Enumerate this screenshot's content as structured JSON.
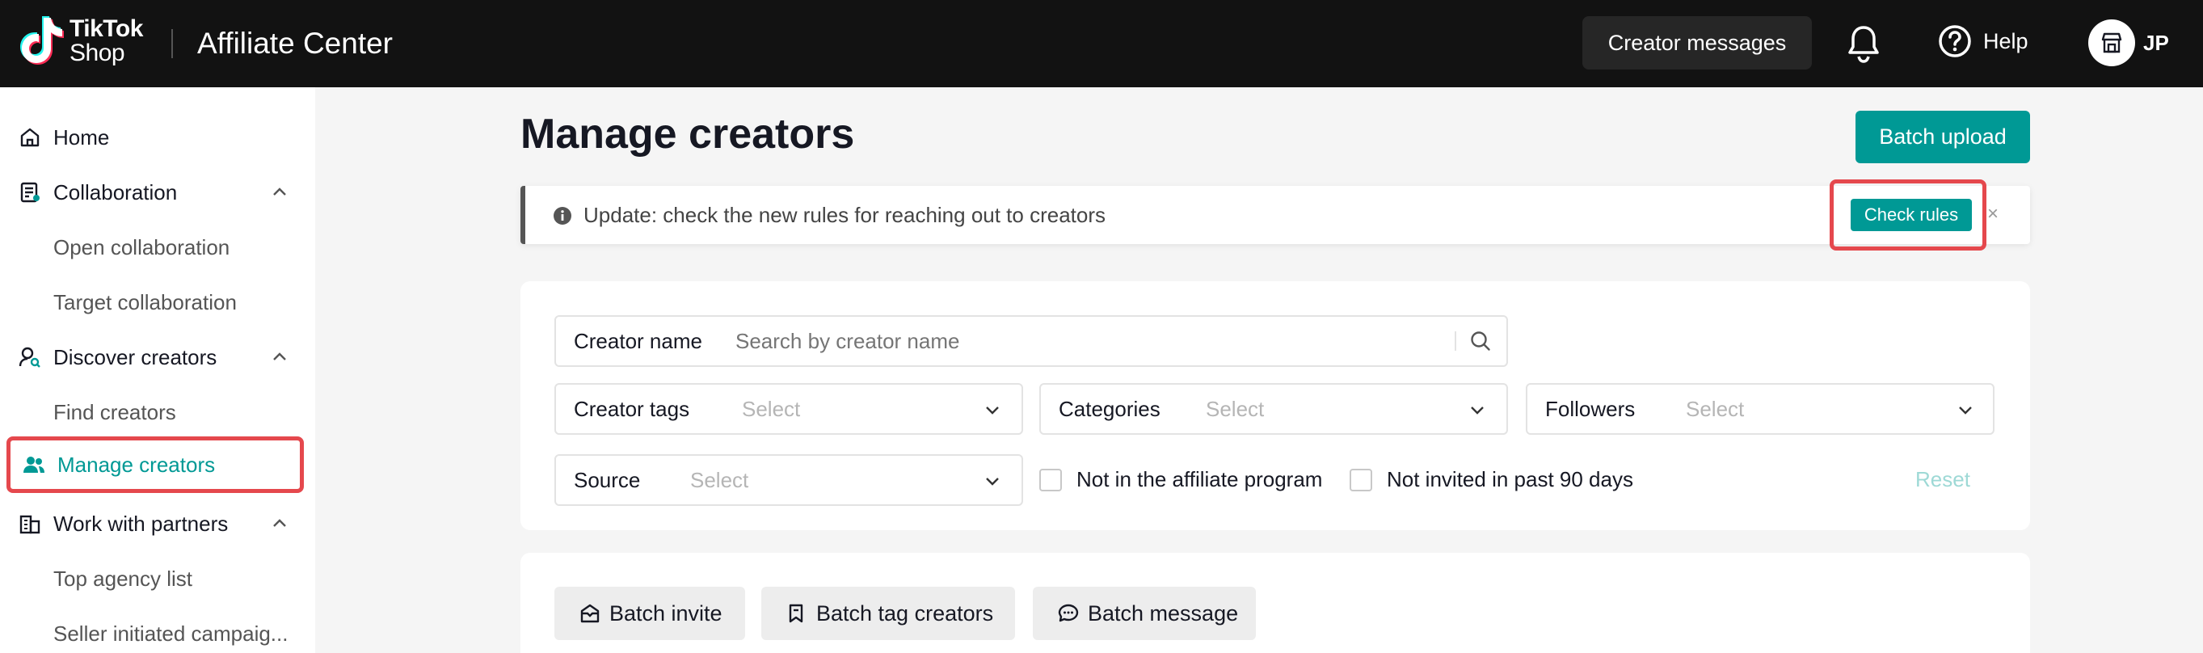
{
  "header": {
    "logo_line1": "TikTok",
    "logo_line2": "Shop",
    "app_title": "Affiliate Center",
    "creator_messages_label": "Creator messages",
    "help_label": "Help",
    "user_initials": "JP"
  },
  "sidebar": {
    "items": [
      {
        "label": "Home",
        "icon": "home-icon"
      },
      {
        "label": "Collaboration",
        "icon": "collaboration-icon",
        "expanded": true
      },
      {
        "label": "Open collaboration"
      },
      {
        "label": "Target collaboration"
      },
      {
        "label": "Discover creators",
        "icon": "discover-icon",
        "expanded": true
      },
      {
        "label": "Find creators"
      },
      {
        "label": "Manage creators",
        "icon": "users-icon",
        "active": true
      },
      {
        "label": "Work with partners",
        "icon": "partners-icon",
        "expanded": true
      },
      {
        "label": "Top agency list"
      },
      {
        "label": "Seller initiated campaig..."
      }
    ]
  },
  "main": {
    "page_title": "Manage creators",
    "batch_upload_label": "Batch upload",
    "notice": {
      "message": "Update: check the new rules for reaching out to creators",
      "action_label": "Check rules",
      "close_glyph": "×"
    },
    "filters": {
      "creator_name": {
        "label": "Creator name",
        "placeholder": "Search by creator name"
      },
      "creator_tags": {
        "label": "Creator tags",
        "value": "Select"
      },
      "categories": {
        "label": "Categories",
        "value": "Select"
      },
      "followers": {
        "label": "Followers",
        "value": "Select"
      },
      "source": {
        "label": "Source",
        "value": "Select"
      },
      "not_in_affiliate": {
        "label": "Not in the affiliate program",
        "checked": false
      },
      "not_invited": {
        "label": "Not invited in past 90 days",
        "checked": false
      },
      "reset_label": "Reset"
    },
    "actions": {
      "batch_invite": "Batch invite",
      "batch_tag": "Batch tag creators",
      "batch_message": "Batch message"
    }
  },
  "colors": {
    "brand_teal": "#009995",
    "highlight_red": "#e5484d",
    "topbar_bg": "#121212"
  }
}
